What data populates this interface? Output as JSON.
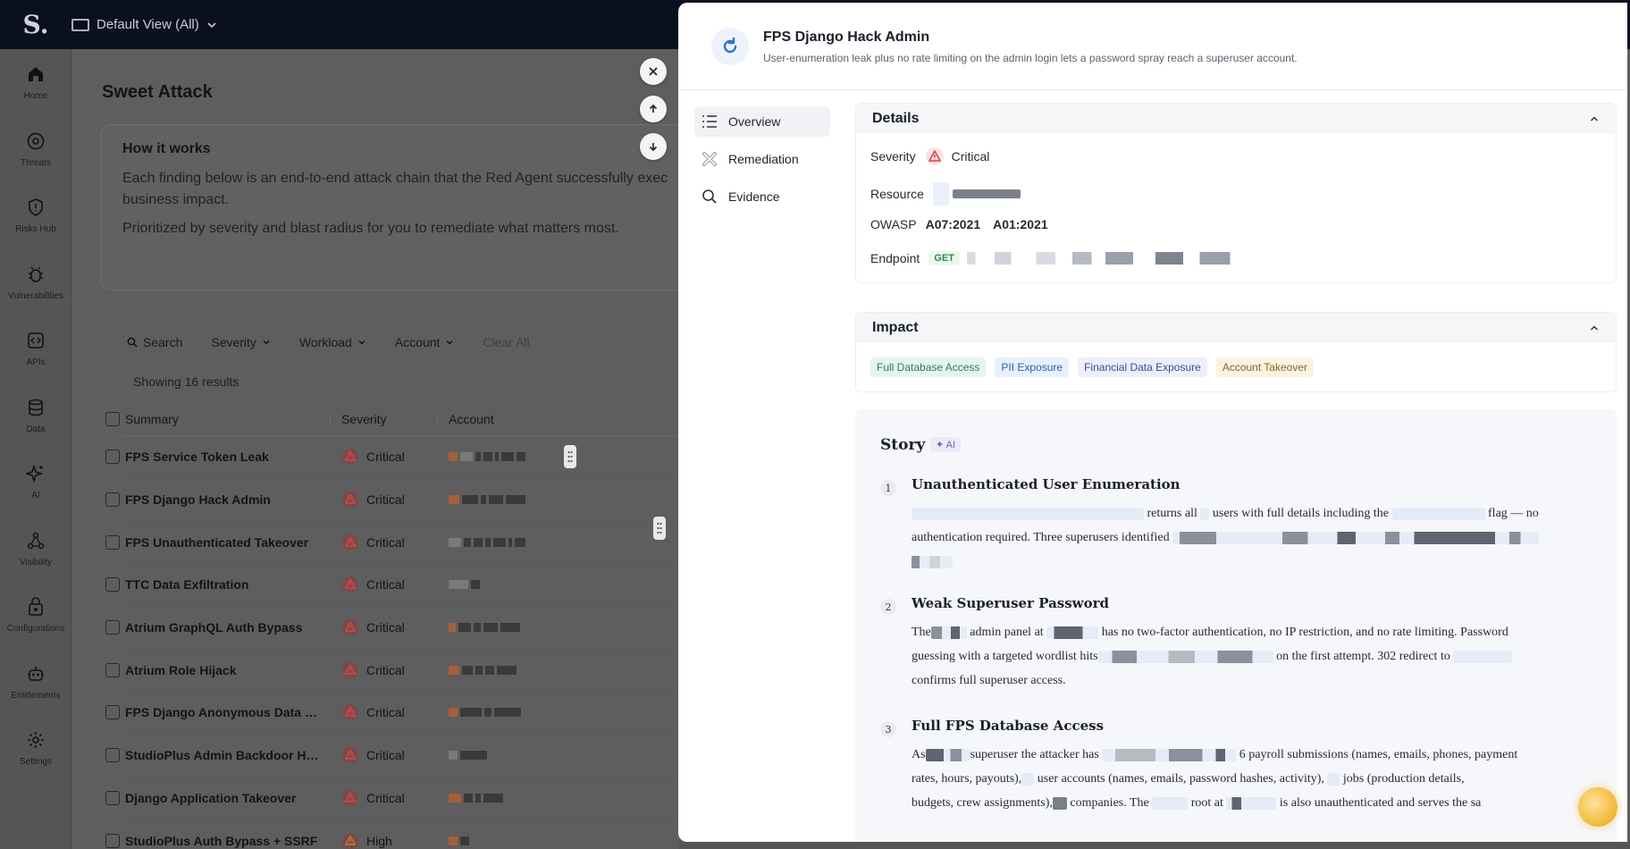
{
  "topbar": {
    "logo_letter": "S.",
    "view_label": "Default View (All)"
  },
  "sidenav": [
    {
      "label": "Home",
      "icon": "home-icon"
    },
    {
      "label": "Threats",
      "icon": "threats-icon"
    },
    {
      "label": "Risks Hub",
      "icon": "shield-icon"
    },
    {
      "label": "Vulnerabilities",
      "icon": "bug-icon"
    },
    {
      "label": "APIs",
      "icon": "code-icon"
    },
    {
      "label": "Data",
      "icon": "database-icon"
    },
    {
      "label": "AI",
      "icon": "sparkle-icon"
    },
    {
      "label": "Visibility",
      "icon": "network-icon"
    },
    {
      "label": "Configurations",
      "icon": "config-icon"
    },
    {
      "label": "Entitlements",
      "icon": "robot-icon"
    },
    {
      "label": "Settings",
      "icon": "gear-icon"
    }
  ],
  "main": {
    "title": "Sweet Attack",
    "how": {
      "title": "How it works",
      "p1": "Each finding below is an end-to-end attack chain that the Red Agent successfully exec",
      "p1b": "business impact.",
      "p2": "Prioritized by severity and blast radius for you to remediate what matters most."
    },
    "filters": {
      "search": "Search",
      "severity": "Severity",
      "workload": "Workload",
      "account": "Account",
      "clear": "Clear All"
    },
    "results": "Showing 16 results",
    "columns": {
      "summary": "Summary",
      "severity": "Severity",
      "account": "Account"
    },
    "rows": [
      {
        "summary": "FPS Service Token Leak",
        "severity": "Critical"
      },
      {
        "summary": "FPS Django Hack Admin",
        "severity": "Critical"
      },
      {
        "summary": "FPS Unauthenticated Takeover",
        "severity": "Critical"
      },
      {
        "summary": "TTC Data Exfiltration",
        "severity": "Critical"
      },
      {
        "summary": "Atrium GraphQL Auth Bypass",
        "severity": "Critical"
      },
      {
        "summary": "Atrium Role Hijack",
        "severity": "Critical"
      },
      {
        "summary": "FPS Django Anonymous Data Tam...",
        "severity": "Critical"
      },
      {
        "summary": "StudioPlus Admin Backdoor Hash",
        "severity": "Critical"
      },
      {
        "summary": "Django Application Takeover",
        "severity": "Critical"
      },
      {
        "summary": "StudioPlus Auth Bypass + SSRF",
        "severity": "High"
      }
    ]
  },
  "drawer": {
    "title": "FPS Django Hack Admin",
    "subtitle": "User-enumeration leak plus no rate limiting on the admin login lets a password spray reach a superuser account.",
    "nav": [
      {
        "label": "Overview",
        "icon": "list-icon",
        "active": true
      },
      {
        "label": "Remediation",
        "icon": "remediation-icon",
        "active": false
      },
      {
        "label": "Evidence",
        "icon": "magnifier-icon",
        "active": false
      }
    ],
    "details": {
      "title": "Details",
      "severity_label": "Severity",
      "severity_value": "Critical",
      "resource_label": "Resource",
      "owasp_label": "OWASP",
      "owasp_values": [
        "A07:2021",
        "A01:2021"
      ],
      "endpoint_label": "Endpoint",
      "endpoint_method": "GET"
    },
    "impact": {
      "title": "Impact",
      "tags": [
        {
          "label": "Full Database Access",
          "bg": "#e6f4f1",
          "fg": "#2a7a6a"
        },
        {
          "label": "PII Exposure",
          "bg": "#e7f0fc",
          "fg": "#2f5fb0"
        },
        {
          "label": "Financial Data Exposure",
          "bg": "#eceef9",
          "fg": "#3f4a9a"
        },
        {
          "label": "Account Takeover",
          "bg": "#fbf3e2",
          "fg": "#8a6420"
        }
      ]
    },
    "story": {
      "title": "Story",
      "ai_badge": "AI",
      "steps": [
        {
          "num": "1",
          "title": "Unauthenticated User Enumeration",
          "t1": "returns all",
          "t2": "users with full details including the",
          "t3": "flag — no",
          "t4": "authentication required. Three superusers identified"
        },
        {
          "num": "2",
          "title": "Weak Superuser Password",
          "t1": "The",
          "t2": "admin panel at",
          "t3": "has no two-factor authentication, no IP restriction, and no rate limiting. Password",
          "t4": "guessing with a targeted wordlist hits",
          "t5": "on the first attempt. 302 redirect to",
          "t6": "confirms full superuser access."
        },
        {
          "num": "3",
          "title": "Full FPS Database Access",
          "t1": "As",
          "t2": "superuser the attacker has",
          "t3": "6 payroll submissions (names, emails, phones, payment",
          "t4": "rates, hours, payouts),",
          "t5": "user accounts (names, emails, password hashes, activity),",
          "t6": "jobs (production details,",
          "t7": "budgets, crew assignments),",
          "t8": "companies. The",
          "t9": "root at",
          "t10": "is also unauthenticated and serves the sa"
        }
      ]
    }
  },
  "colors": {
    "topbar": "#0b1020",
    "critical": "#d64545",
    "accent": "#2f6fd6"
  }
}
